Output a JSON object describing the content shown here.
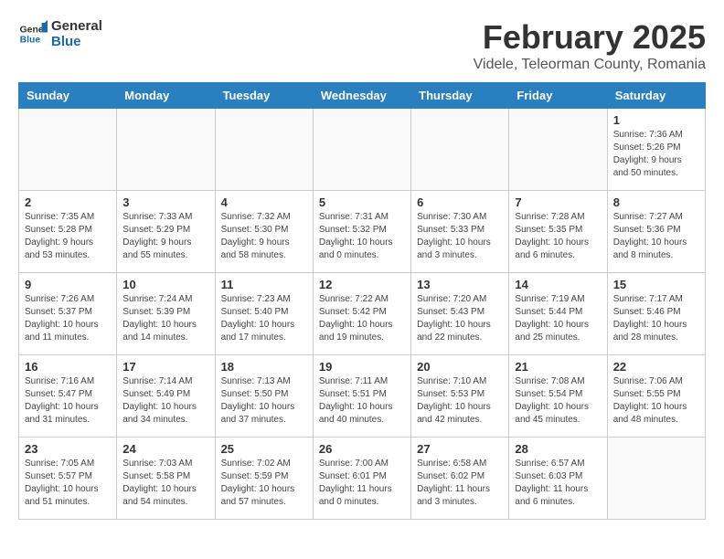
{
  "header": {
    "logo_general": "General",
    "logo_blue": "Blue",
    "month": "February 2025",
    "location": "Videle, Teleorman County, Romania"
  },
  "weekdays": [
    "Sunday",
    "Monday",
    "Tuesday",
    "Wednesday",
    "Thursday",
    "Friday",
    "Saturday"
  ],
  "weeks": [
    [
      {
        "day": "",
        "info": ""
      },
      {
        "day": "",
        "info": ""
      },
      {
        "day": "",
        "info": ""
      },
      {
        "day": "",
        "info": ""
      },
      {
        "day": "",
        "info": ""
      },
      {
        "day": "",
        "info": ""
      },
      {
        "day": "1",
        "info": "Sunrise: 7:36 AM\nSunset: 5:26 PM\nDaylight: 9 hours\nand 50 minutes."
      }
    ],
    [
      {
        "day": "2",
        "info": "Sunrise: 7:35 AM\nSunset: 5:28 PM\nDaylight: 9 hours\nand 53 minutes."
      },
      {
        "day": "3",
        "info": "Sunrise: 7:33 AM\nSunset: 5:29 PM\nDaylight: 9 hours\nand 55 minutes."
      },
      {
        "day": "4",
        "info": "Sunrise: 7:32 AM\nSunset: 5:30 PM\nDaylight: 9 hours\nand 58 minutes."
      },
      {
        "day": "5",
        "info": "Sunrise: 7:31 AM\nSunset: 5:32 PM\nDaylight: 10 hours\nand 0 minutes."
      },
      {
        "day": "6",
        "info": "Sunrise: 7:30 AM\nSunset: 5:33 PM\nDaylight: 10 hours\nand 3 minutes."
      },
      {
        "day": "7",
        "info": "Sunrise: 7:28 AM\nSunset: 5:35 PM\nDaylight: 10 hours\nand 6 minutes."
      },
      {
        "day": "8",
        "info": "Sunrise: 7:27 AM\nSunset: 5:36 PM\nDaylight: 10 hours\nand 8 minutes."
      }
    ],
    [
      {
        "day": "9",
        "info": "Sunrise: 7:26 AM\nSunset: 5:37 PM\nDaylight: 10 hours\nand 11 minutes."
      },
      {
        "day": "10",
        "info": "Sunrise: 7:24 AM\nSunset: 5:39 PM\nDaylight: 10 hours\nand 14 minutes."
      },
      {
        "day": "11",
        "info": "Sunrise: 7:23 AM\nSunset: 5:40 PM\nDaylight: 10 hours\nand 17 minutes."
      },
      {
        "day": "12",
        "info": "Sunrise: 7:22 AM\nSunset: 5:42 PM\nDaylight: 10 hours\nand 19 minutes."
      },
      {
        "day": "13",
        "info": "Sunrise: 7:20 AM\nSunset: 5:43 PM\nDaylight: 10 hours\nand 22 minutes."
      },
      {
        "day": "14",
        "info": "Sunrise: 7:19 AM\nSunset: 5:44 PM\nDaylight: 10 hours\nand 25 minutes."
      },
      {
        "day": "15",
        "info": "Sunrise: 7:17 AM\nSunset: 5:46 PM\nDaylight: 10 hours\nand 28 minutes."
      }
    ],
    [
      {
        "day": "16",
        "info": "Sunrise: 7:16 AM\nSunset: 5:47 PM\nDaylight: 10 hours\nand 31 minutes."
      },
      {
        "day": "17",
        "info": "Sunrise: 7:14 AM\nSunset: 5:49 PM\nDaylight: 10 hours\nand 34 minutes."
      },
      {
        "day": "18",
        "info": "Sunrise: 7:13 AM\nSunset: 5:50 PM\nDaylight: 10 hours\nand 37 minutes."
      },
      {
        "day": "19",
        "info": "Sunrise: 7:11 AM\nSunset: 5:51 PM\nDaylight: 10 hours\nand 40 minutes."
      },
      {
        "day": "20",
        "info": "Sunrise: 7:10 AM\nSunset: 5:53 PM\nDaylight: 10 hours\nand 42 minutes."
      },
      {
        "day": "21",
        "info": "Sunrise: 7:08 AM\nSunset: 5:54 PM\nDaylight: 10 hours\nand 45 minutes."
      },
      {
        "day": "22",
        "info": "Sunrise: 7:06 AM\nSunset: 5:55 PM\nDaylight: 10 hours\nand 48 minutes."
      }
    ],
    [
      {
        "day": "23",
        "info": "Sunrise: 7:05 AM\nSunset: 5:57 PM\nDaylight: 10 hours\nand 51 minutes."
      },
      {
        "day": "24",
        "info": "Sunrise: 7:03 AM\nSunset: 5:58 PM\nDaylight: 10 hours\nand 54 minutes."
      },
      {
        "day": "25",
        "info": "Sunrise: 7:02 AM\nSunset: 5:59 PM\nDaylight: 10 hours\nand 57 minutes."
      },
      {
        "day": "26",
        "info": "Sunrise: 7:00 AM\nSunset: 6:01 PM\nDaylight: 11 hours\nand 0 minutes."
      },
      {
        "day": "27",
        "info": "Sunrise: 6:58 AM\nSunset: 6:02 PM\nDaylight: 11 hours\nand 3 minutes."
      },
      {
        "day": "28",
        "info": "Sunrise: 6:57 AM\nSunset: 6:03 PM\nDaylight: 11 hours\nand 6 minutes."
      },
      {
        "day": "",
        "info": ""
      }
    ]
  ]
}
